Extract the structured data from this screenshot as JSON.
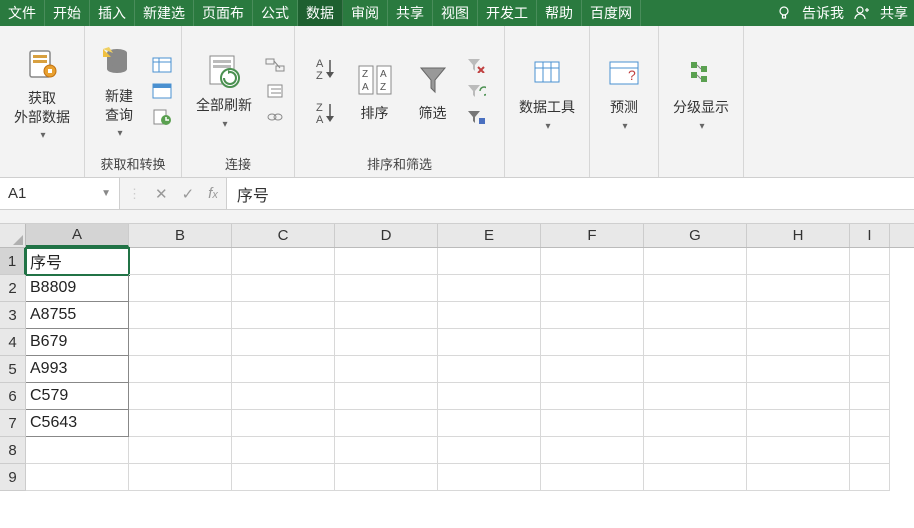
{
  "menu": {
    "items": [
      "文件",
      "开始",
      "插入",
      "新建选",
      "页面布",
      "公式",
      "数据",
      "审阅",
      "共享",
      "视图",
      "开发工",
      "帮助",
      "百度网"
    ],
    "active_index": 6,
    "tell_me": "告诉我",
    "share": "共享"
  },
  "ribbon": {
    "groups": [
      {
        "label": "",
        "buttons": [
          {
            "name": "get-external-data",
            "text": "获取\n外部数据"
          }
        ]
      },
      {
        "label": "获取和转换",
        "buttons": [
          {
            "name": "new-query",
            "text": "新建\n查询"
          }
        ]
      },
      {
        "label": "连接",
        "buttons": [
          {
            "name": "refresh-all",
            "text": "全部刷新"
          }
        ]
      },
      {
        "label": "排序和筛选",
        "buttons": [
          {
            "name": "sort-az",
            "text": ""
          },
          {
            "name": "sort-za",
            "text": ""
          },
          {
            "name": "sort",
            "text": "排序"
          },
          {
            "name": "filter",
            "text": "筛选"
          }
        ]
      },
      {
        "label": "",
        "buttons": [
          {
            "name": "data-tools",
            "text": "数据工具"
          }
        ]
      },
      {
        "label": "",
        "buttons": [
          {
            "name": "forecast",
            "text": "预测"
          }
        ]
      },
      {
        "label": "",
        "buttons": [
          {
            "name": "outline",
            "text": "分级显示"
          }
        ]
      }
    ]
  },
  "formula_bar": {
    "namebox": "A1",
    "value": "序号"
  },
  "grid": {
    "columns": [
      "A",
      "B",
      "C",
      "D",
      "E",
      "F",
      "G",
      "H",
      "I"
    ],
    "rows": [
      1,
      2,
      3,
      4,
      5,
      6,
      7,
      8,
      9
    ],
    "active_cell": "A1",
    "data": {
      "A1": "序号",
      "A2": "B8809",
      "A3": "A8755",
      "A4": "B679",
      "A5": "A993",
      "A6": "C579",
      "A7": "C5643"
    }
  }
}
